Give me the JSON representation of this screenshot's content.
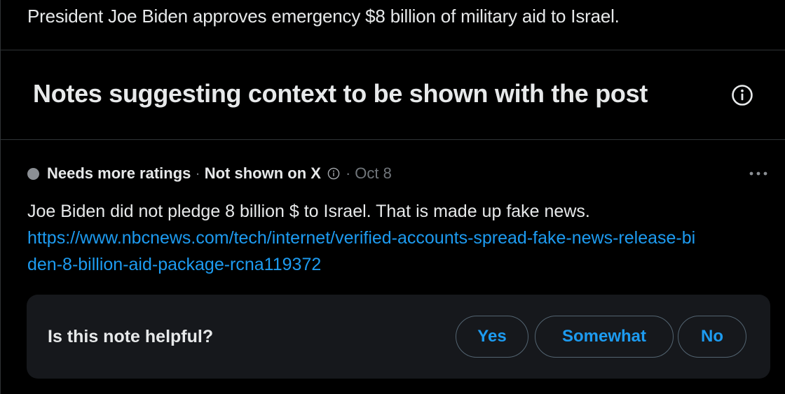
{
  "post": {
    "text": "President Joe Biden approves emergency $8 billion of military aid to Israel."
  },
  "notes_section": {
    "heading": "Notes suggesting context to be shown with the post",
    "info_icon": "info-icon"
  },
  "note": {
    "status_label": "Needs more ratings",
    "visibility_label": "Not shown on X",
    "separator": "·",
    "date": "Oct 8",
    "status_color": "#8b8f94",
    "body_text": "Joe Biden did not pledge 8 billion $ to Israel. That is made up fake news.",
    "link": "https://www.nbcnews.com/tech/internet/verified-accounts-spread-fake-news-release-biden-8-billion-aid-package-rcna119372",
    "more_icon": "more-horizontal-icon"
  },
  "helpful_prompt": {
    "question": "Is this note helpful?",
    "options": {
      "yes": "Yes",
      "somewhat": "Somewhat",
      "no": "No"
    }
  },
  "colors": {
    "background": "#000000",
    "text": "#e7e9ea",
    "muted": "#71767b",
    "accent": "#1d9bf0",
    "card": "#16181c",
    "border": "#2f3336"
  }
}
